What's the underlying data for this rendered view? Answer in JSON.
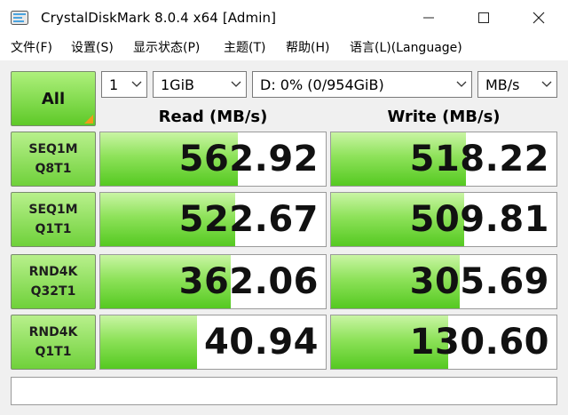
{
  "window": {
    "title": "CrystalDiskMark 8.0.4 x64 [Admin]",
    "icon": "crystaldiskmark-app-icon",
    "controls": {
      "minimize": "minimize-icon",
      "maximize": "maximize-icon",
      "close": "close-icon"
    }
  },
  "menu": {
    "items": [
      {
        "label": "文件(F)"
      },
      {
        "label": "设置(S)"
      },
      {
        "label": "显示状态(P)"
      },
      {
        "label": "主题(T)"
      },
      {
        "label": "帮助(H)"
      },
      {
        "label": "语言(L)(Language)"
      }
    ]
  },
  "controls": {
    "all_label": "All",
    "count": "1",
    "size": "1GiB",
    "drive": "D: 0% (0/954GiB)",
    "unit": "MB/s"
  },
  "headers": {
    "read": "Read (MB/s)",
    "write": "Write (MB/s)"
  },
  "tests": [
    {
      "line1": "SEQ1M",
      "line2": "Q8T1",
      "read": "562.92",
      "write": "518.22",
      "read_fill": 0.61,
      "write_fill": 0.6
    },
    {
      "line1": "SEQ1M",
      "line2": "Q1T1",
      "read": "522.67",
      "write": "509.81",
      "read_fill": 0.6,
      "write_fill": 0.59
    },
    {
      "line1": "RND4K",
      "line2": "Q32T1",
      "read": "362.06",
      "write": "305.69",
      "read_fill": 0.58,
      "write_fill": 0.57
    },
    {
      "line1": "RND4K",
      "line2": "Q1T1",
      "read": "40.94",
      "write": "130.60",
      "read_fill": 0.43,
      "write_fill": 0.52
    }
  ],
  "colors": {
    "accent_green": "#55c921",
    "corner_orange": "#f29b1a"
  },
  "comment": ""
}
